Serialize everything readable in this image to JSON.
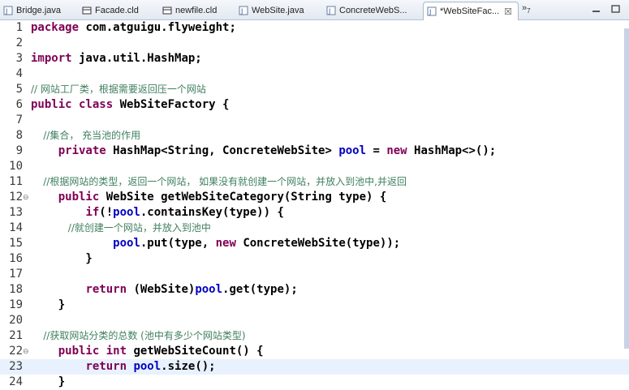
{
  "tabs": [
    {
      "label": "Bridge.java",
      "icon": "java-file-icon",
      "active": false
    },
    {
      "label": "Facade.cld",
      "icon": "class-diagram-icon",
      "active": false
    },
    {
      "label": "newfile.cld",
      "icon": "class-diagram-icon",
      "active": false
    },
    {
      "label": "WebSite.java",
      "icon": "java-file-icon",
      "active": false
    },
    {
      "label": "ConcreteWebS...",
      "icon": "java-file-icon",
      "active": false
    },
    {
      "label": "*WebSiteFac...",
      "icon": "java-file-icon",
      "active": true
    }
  ],
  "tab_close": "☒",
  "overflow": {
    "label": "»",
    "count": "7"
  },
  "colors": {
    "keyword": "#7f0055",
    "comment": "#3f7f5f",
    "field": "#0000c0",
    "current_line": "#e8f2fe"
  },
  "lines": [
    {
      "n": "1",
      "code": "package com.atguigu.flyweight;"
    },
    {
      "n": "2",
      "code": ""
    },
    {
      "n": "3",
      "code": "import java.util.HashMap;"
    },
    {
      "n": "4",
      "code": ""
    },
    {
      "n": "5",
      "code": "// 网站工厂类，根据需要返回压一个网站"
    },
    {
      "n": "6",
      "code": "public class WebSiteFactory {"
    },
    {
      "n": "7",
      "code": ""
    },
    {
      "n": "8",
      "code": "    //集合， 充当池的作用"
    },
    {
      "n": "9",
      "code": "    private HashMap<String, ConcreteWebSite> pool = new HashMap<>();"
    },
    {
      "n": "10",
      "code": ""
    },
    {
      "n": "11",
      "code": "    //根据网站的类型，返回一个网站， 如果没有就创建一个网站，并放入到池中,并返回"
    },
    {
      "n": "12",
      "code": "    public WebSite getWebSiteCategory(String type) {"
    },
    {
      "n": "13",
      "code": "        if(!pool.containsKey(type)) {"
    },
    {
      "n": "14",
      "code": "            //就创建一个网站，并放入到池中"
    },
    {
      "n": "15",
      "code": "            pool.put(type, new ConcreteWebSite(type));"
    },
    {
      "n": "16",
      "code": "        }"
    },
    {
      "n": "17",
      "code": ""
    },
    {
      "n": "18",
      "code": "        return (WebSite)pool.get(type);"
    },
    {
      "n": "19",
      "code": "    }"
    },
    {
      "n": "20",
      "code": ""
    },
    {
      "n": "21",
      "code": "    //获取网站分类的总数 (池中有多少个网站类型)"
    },
    {
      "n": "22",
      "code": "    public int getWebSiteCount() {"
    },
    {
      "n": "23",
      "code": "        return pool.size();"
    },
    {
      "n": "24",
      "code": "    }"
    }
  ]
}
